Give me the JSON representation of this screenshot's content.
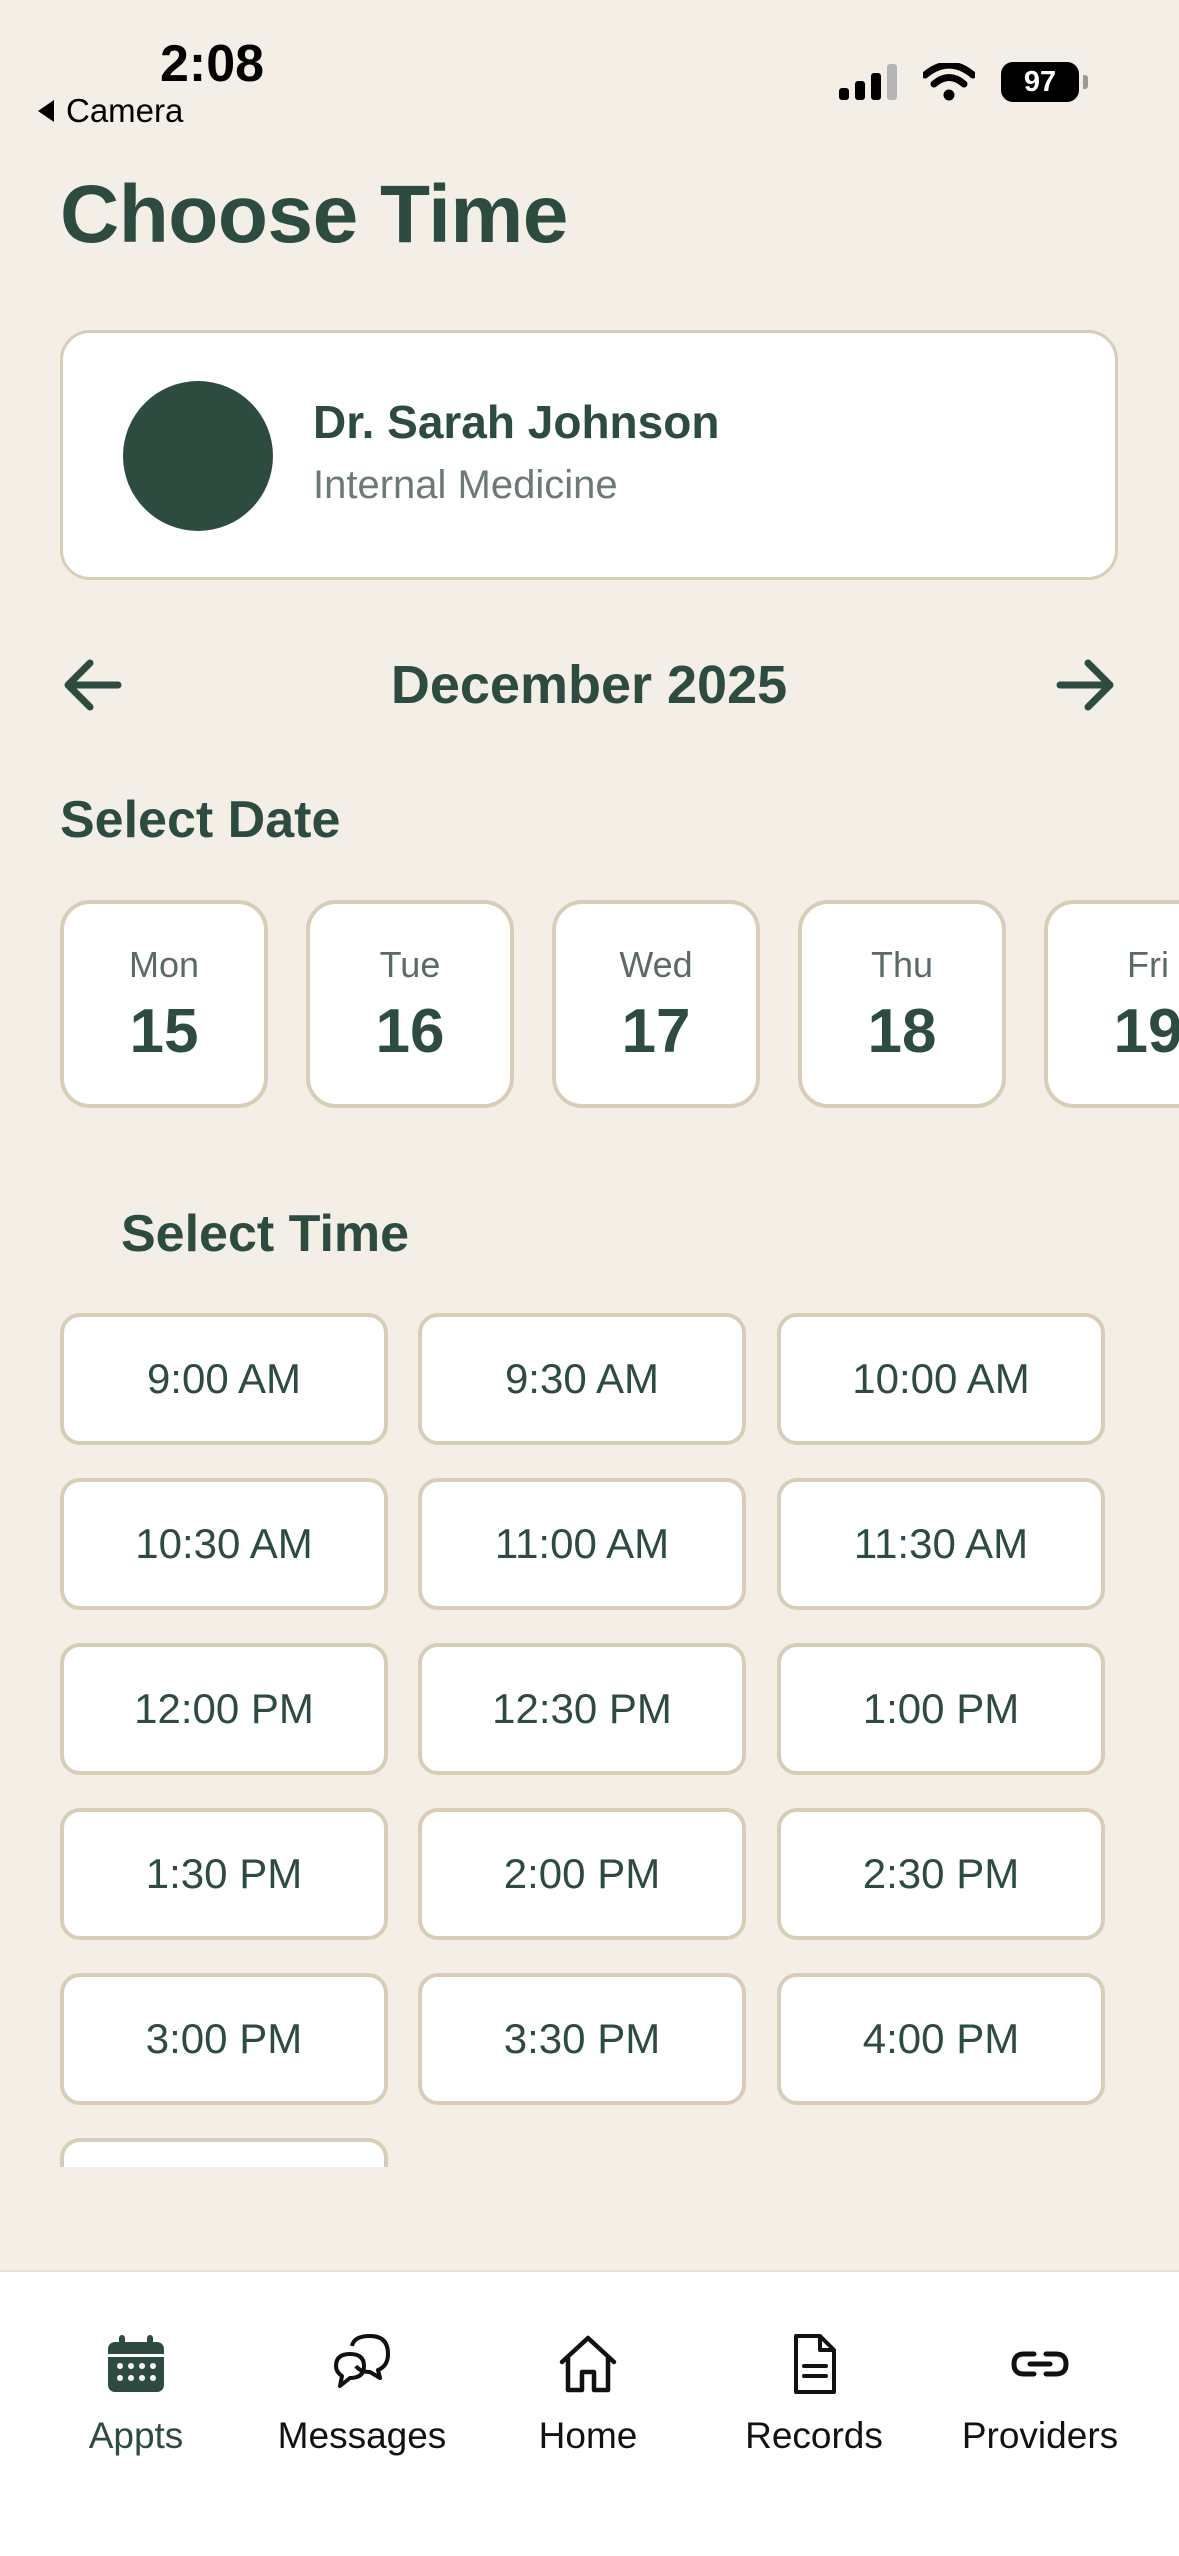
{
  "status_bar": {
    "time": "2:08",
    "back_label": "Camera",
    "battery": "97"
  },
  "page_title": "Choose Time",
  "doctor": {
    "name": "Dr. Sarah Johnson",
    "specialty": "Internal Medicine"
  },
  "calendar": {
    "month_label": "December 2025"
  },
  "select_date_label": "Select Date",
  "dates": [
    {
      "dow": "Mon",
      "day": "15"
    },
    {
      "dow": "Tue",
      "day": "16"
    },
    {
      "dow": "Wed",
      "day": "17"
    },
    {
      "dow": "Thu",
      "day": "18"
    },
    {
      "dow": "Fri",
      "day": "19"
    }
  ],
  "select_time_label": "Select Time",
  "time_slots": [
    "9:00 AM",
    "9:30 AM",
    "10:00 AM",
    "10:30 AM",
    "11:00 AM",
    "11:30 AM",
    "12:00 PM",
    "12:30 PM",
    "1:00 PM",
    "1:30 PM",
    "2:00 PM",
    "2:30 PM",
    "3:00 PM",
    "3:30 PM",
    "4:00 PM",
    ""
  ],
  "tabs": [
    {
      "label": "Appts",
      "icon": "calendar-icon",
      "active": true
    },
    {
      "label": "Messages",
      "icon": "chat-bubbles-icon",
      "active": false
    },
    {
      "label": "Home",
      "icon": "home-icon",
      "active": false
    },
    {
      "label": "Records",
      "icon": "document-icon",
      "active": false
    },
    {
      "label": "Providers",
      "icon": "link-icon",
      "active": false
    }
  ],
  "colors": {
    "accent": "#2d4b3f",
    "background": "#f3efe7",
    "border": "#d8cdb9"
  }
}
